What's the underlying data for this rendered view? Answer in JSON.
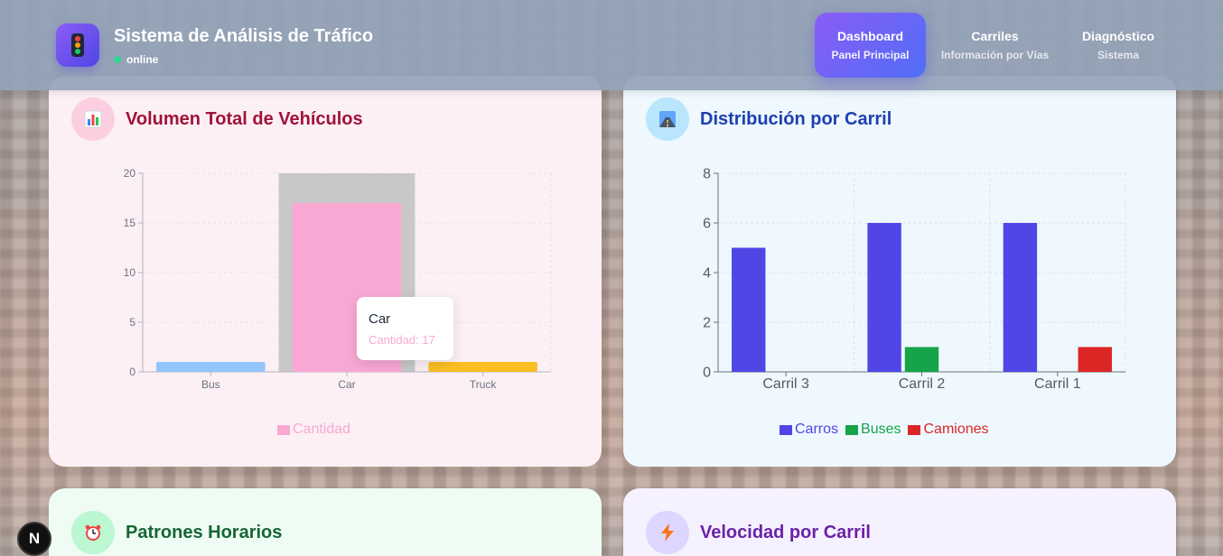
{
  "app": {
    "title": "Sistema de Análisis de Tráfico",
    "status": "online",
    "accent": "#6d5cf0"
  },
  "nav": [
    {
      "label": "Dashboard",
      "sub": "Panel Principal",
      "active": true
    },
    {
      "label": "Carriles",
      "sub": "Información por Vías",
      "active": false
    },
    {
      "label": "Diagnóstico",
      "sub": "Sistema",
      "active": false
    }
  ],
  "cards": {
    "volumen": {
      "title": "Volumen Total de Vehículos",
      "icon": "bar-chart-icon",
      "title_color": "#9f1239"
    },
    "distribucion": {
      "title": "Distribución por Carril",
      "icon": "road-icon",
      "title_color": "#1e40af"
    },
    "patrones": {
      "title": "Patrones Horarios",
      "icon": "alarm-clock-icon",
      "title_color": "#166534"
    },
    "velocidad": {
      "title": "Velocidad por Carril",
      "icon": "lightning-icon",
      "title_color": "#6b21a8"
    }
  },
  "tooltip": {
    "title": "Car",
    "value_label": "Cantidad: 17"
  },
  "chart_data": [
    {
      "type": "bar",
      "categories": [
        "Bus",
        "Car",
        "Truck"
      ],
      "series": [
        {
          "name": "Cantidad",
          "values": [
            1,
            17,
            1
          ],
          "colors": [
            "#93c5fd",
            "#f9a8d4",
            "#fbbf24"
          ]
        }
      ],
      "ylim": [
        0,
        20
      ],
      "yticks": [
        0,
        5,
        10,
        15,
        20
      ],
      "grid": true,
      "legend": "bottom",
      "highlighted_category": "Car"
    },
    {
      "type": "bar",
      "categories": [
        "Carril 3",
        "Carril 2",
        "Carril 1"
      ],
      "series": [
        {
          "name": "Carros",
          "values": [
            5,
            6,
            6
          ],
          "color": "#4f46e5"
        },
        {
          "name": "Buses",
          "values": [
            0,
            1,
            0
          ],
          "color": "#16a34a"
        },
        {
          "name": "Camiones",
          "values": [
            0,
            0,
            1
          ],
          "color": "#dc2626"
        }
      ],
      "ylim": [
        0,
        8
      ],
      "yticks": [
        0,
        2,
        4,
        6,
        8
      ],
      "grid": true,
      "legend": "bottom"
    }
  ],
  "nextjs_badge": "N"
}
